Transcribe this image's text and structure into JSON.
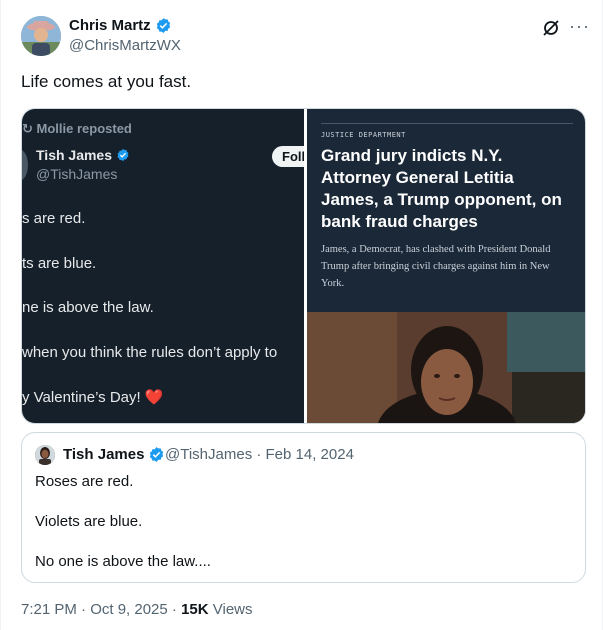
{
  "author": {
    "name": "Chris Martz",
    "handle": "@ChrisMartzWX"
  },
  "tweet_text": "Life comes at you fast.",
  "media": {
    "left": {
      "repost_label": "Mollie reposted",
      "name": "Tish James",
      "handle": "@TishJames",
      "follow_label": "Foll",
      "lines": [
        "s are red.",
        "ts are blue.",
        "ne is above the law.",
        " when you think the rules don’t apply to",
        "y Valentine’s Day! ❤️"
      ]
    },
    "right": {
      "kicker": "JUSTICE DEPARTMENT",
      "headline": "Grand jury indicts N.Y. Attorney General Letitia James, a Trump opponent, on bank fraud charges",
      "dek": "James, a Democrat, has clashed with President Donald Trump after bringing civil charges against him in New York."
    }
  },
  "quote": {
    "name": "Tish James",
    "handle_date": "@TishJames · Feb 14, 2024",
    "lines": [
      "Roses are red.",
      "Violets are blue.",
      "No one is above the law...."
    ]
  },
  "meta": {
    "time_date": "7:21 PM · Oct 9, 2025 · ",
    "views_count": "15K",
    "views_label": " Views"
  },
  "colors": {
    "verified": "#1d9bf0",
    "muted": "#536471",
    "dark_panel": "#15202b"
  },
  "icons": [
    "verified-badge-icon",
    "grok-icon",
    "more-icon",
    "repost-icon",
    "heart-icon"
  ]
}
